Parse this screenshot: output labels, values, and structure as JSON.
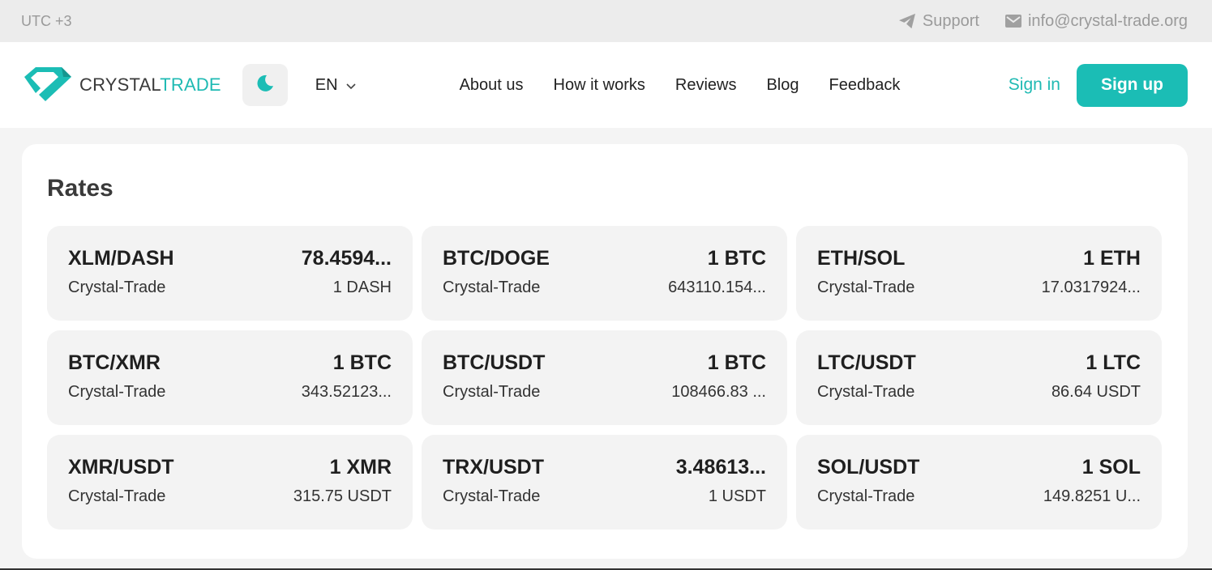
{
  "topbar": {
    "timezone": "UTC +3",
    "support_label": "Support",
    "email": "info@crystal-trade.org"
  },
  "header": {
    "logo_part1": "CRYSTAL",
    "logo_part2": "TRADE",
    "language": "EN",
    "nav": [
      "About us",
      "How it works",
      "Reviews",
      "Blog",
      "Feedback"
    ],
    "sign_in": "Sign in",
    "sign_up": "Sign up"
  },
  "colors": {
    "accent": "#1bbdb5",
    "card_bg": "#f3f3f3"
  },
  "rates": {
    "title": "Rates",
    "cards": [
      {
        "pair": "XLM/DASH",
        "amount": "78.4594...",
        "provider": "Crystal-Trade",
        "quote": "1 DASH"
      },
      {
        "pair": "BTC/DOGE",
        "amount": "1 BTC",
        "provider": "Crystal-Trade",
        "quote": "643110.154..."
      },
      {
        "pair": "ETH/SOL",
        "amount": "1 ETH",
        "provider": "Crystal-Trade",
        "quote": "17.0317924..."
      },
      {
        "pair": "BTC/XMR",
        "amount": "1 BTC",
        "provider": "Crystal-Trade",
        "quote": "343.52123..."
      },
      {
        "pair": "BTC/USDT",
        "amount": "1 BTC",
        "provider": "Crystal-Trade",
        "quote": "108466.83 ..."
      },
      {
        "pair": "LTC/USDT",
        "amount": "1 LTC",
        "provider": "Crystal-Trade",
        "quote": "86.64 USDT"
      },
      {
        "pair": "XMR/USDT",
        "amount": "1 XMR",
        "provider": "Crystal-Trade",
        "quote": "315.75 USDT"
      },
      {
        "pair": "TRX/USDT",
        "amount": "3.48613...",
        "provider": "Crystal-Trade",
        "quote": "1 USDT"
      },
      {
        "pair": "SOL/USDT",
        "amount": "1 SOL",
        "provider": "Crystal-Trade",
        "quote": "149.8251 U..."
      }
    ]
  }
}
